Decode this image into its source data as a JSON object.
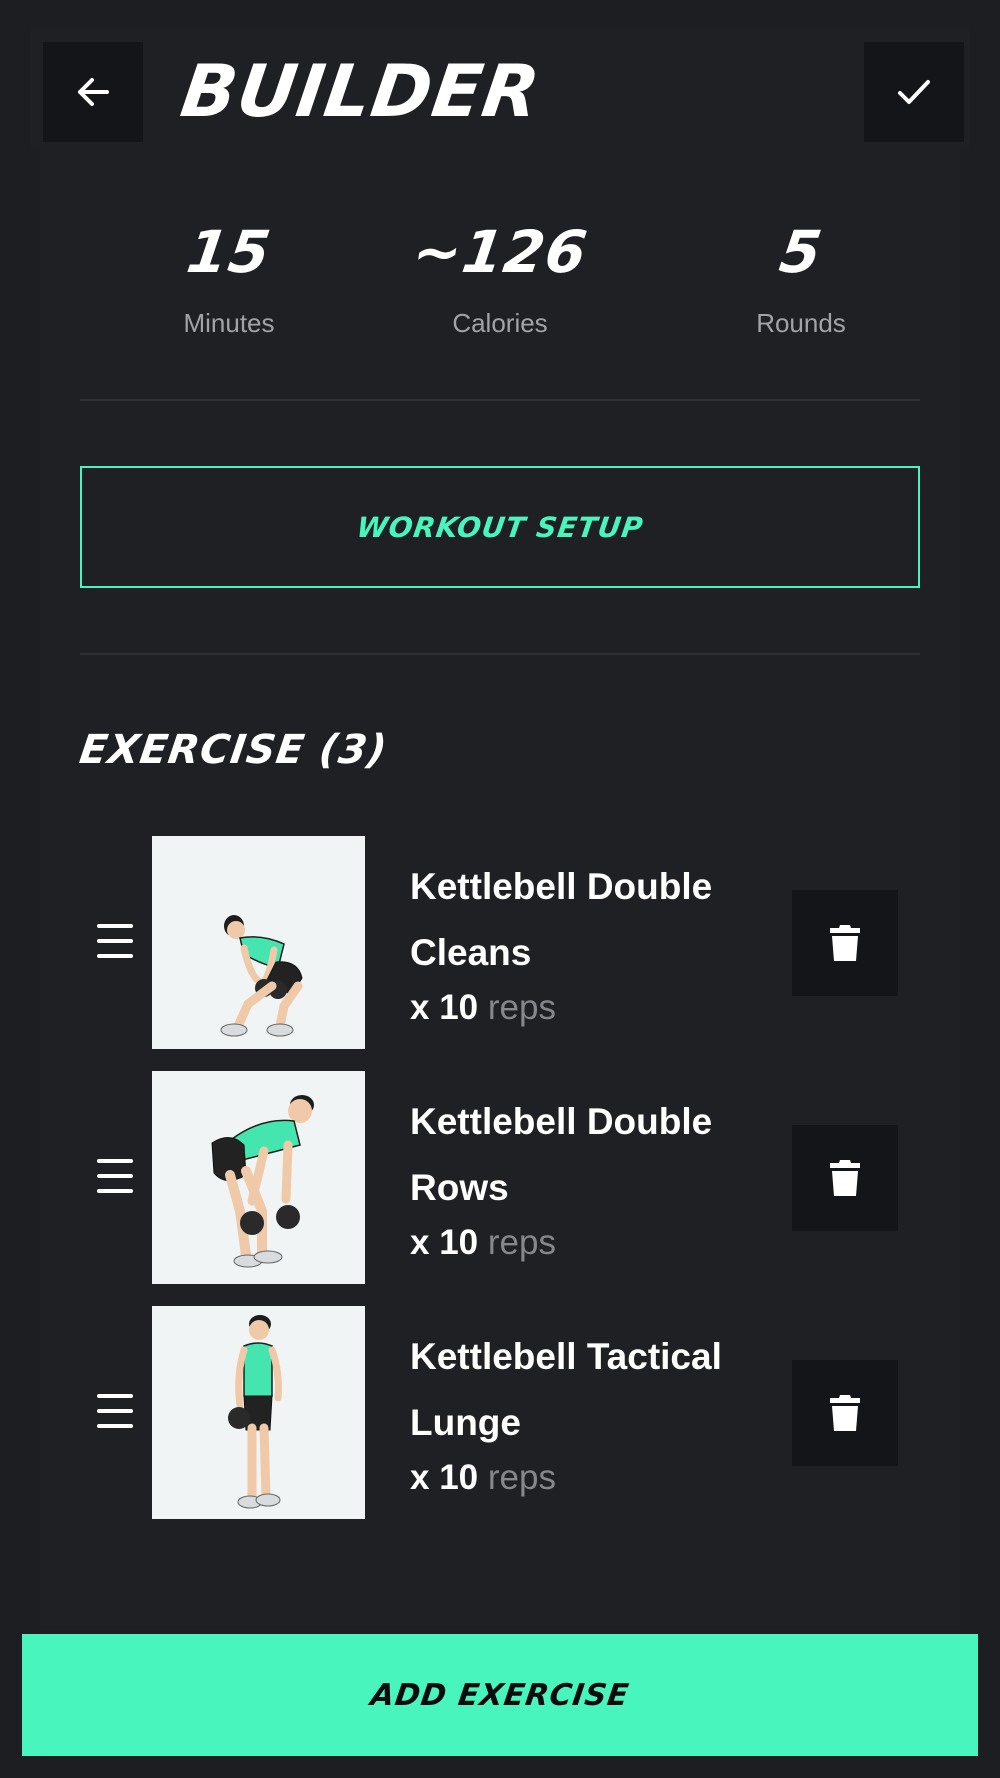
{
  "header": {
    "title": "BUILDER",
    "back_icon": "arrow-left-icon",
    "done_icon": "checkmark-icon"
  },
  "stats": [
    {
      "value": "15",
      "label": "Minutes"
    },
    {
      "value": "~126",
      "label": "Calories"
    },
    {
      "value": "5",
      "label": "Rounds"
    }
  ],
  "setup": {
    "label": "WORKOUT SETUP"
  },
  "exercises_section": {
    "title": "EXERCISE (3)"
  },
  "exercises": [
    {
      "name": "Kettlebell Double Cleans",
      "reps": "x 10",
      "unit": "reps"
    },
    {
      "name": "Kettlebell Double Rows",
      "reps": "x 10",
      "unit": "reps"
    },
    {
      "name": "Kettlebell Tactical Lunge",
      "reps": "x 10",
      "unit": "reps"
    }
  ],
  "footer": {
    "add_label": "ADD EXERCISE"
  },
  "colors": {
    "background": "#1d1e21",
    "accent": "#48f5bd",
    "button_dark": "#141519",
    "muted_text": "#a2a3a7",
    "thumbnail_bg": "#f1f4f5"
  }
}
